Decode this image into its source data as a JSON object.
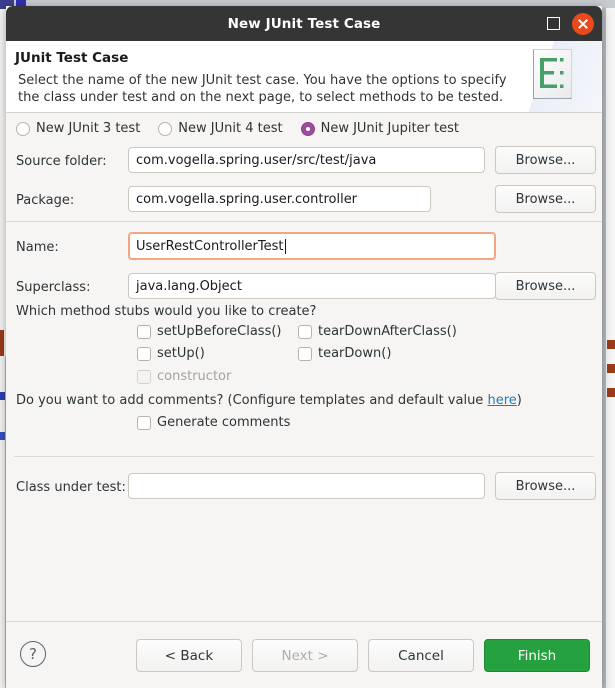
{
  "window": {
    "title": "New JUnit Test Case",
    "maximize_icon": "maximize-square-icon",
    "close_icon": "close-x-icon"
  },
  "header": {
    "title": "JUnit Test Case",
    "description": "Select the name of the new JUnit test case. You have the options to specify the class under test and on the next page, to select methods to be tested.",
    "icon": "junit-test-case-icon"
  },
  "test_kind": {
    "options": [
      {
        "label": "New JUnit 3 test",
        "selected": false
      },
      {
        "label": "New JUnit 4 test",
        "selected": false
      },
      {
        "label": "New JUnit Jupiter test",
        "selected": true
      }
    ]
  },
  "fields": {
    "source_folder": {
      "label": "Source folder:",
      "value": "com.vogella.spring.user/src/test/java",
      "browse_label": "Browse...",
      "focused": false
    },
    "package": {
      "label": "Package:",
      "value": "com.vogella.spring.user.controller",
      "browse_label": "Browse...",
      "focused": false
    },
    "name": {
      "label": "Name:",
      "value": "UserRestControllerTest",
      "focused": true
    },
    "superclass": {
      "label": "Superclass:",
      "value": "java.lang.Object",
      "browse_label": "Browse...",
      "focused": false
    },
    "class_under_test": {
      "label": "Class under test:",
      "value": "",
      "browse_label": "Browse...",
      "focused": false
    }
  },
  "stubs": {
    "question": "Which method stubs would you like to create?",
    "items": [
      {
        "label": "setUpBeforeClass()",
        "checked": false,
        "enabled": true
      },
      {
        "label": "tearDownAfterClass()",
        "checked": false,
        "enabled": true
      },
      {
        "label": "setUp()",
        "checked": false,
        "enabled": true
      },
      {
        "label": "tearDown()",
        "checked": false,
        "enabled": true
      },
      {
        "label": "constructor",
        "checked": false,
        "enabled": false
      }
    ]
  },
  "comments": {
    "question_prefix": "Do you want to add comments? (Configure templates and default value ",
    "link_label": "here",
    "question_suffix": ")",
    "checkbox_label": "Generate comments",
    "checked": false
  },
  "footer": {
    "help_label": "?",
    "back_label": "< Back",
    "next_label": "Next >",
    "next_enabled": false,
    "cancel_label": "Cancel",
    "finish_label": "Finish"
  },
  "colors": {
    "titlebar": "#353535",
    "close_button": "#e8491d",
    "radio_selected": "#9c4e9c",
    "focus_border": "#f0a884",
    "link": "#2a7ab0",
    "finish_button": "#26a13f",
    "icon_green": "#46a06a"
  }
}
